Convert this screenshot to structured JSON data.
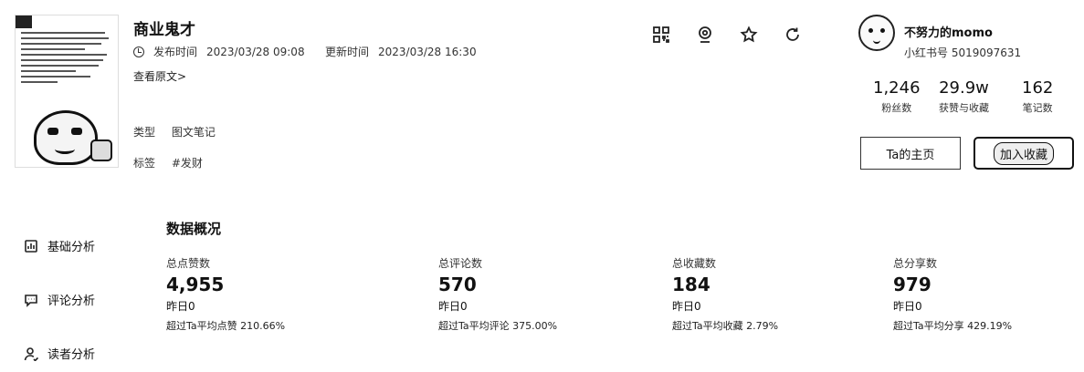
{
  "note": {
    "title": "商业鬼才",
    "publish_label": "发布时间",
    "publish_time": "2023/03/28 09:08",
    "update_label": "更新时间",
    "update_time": "2023/03/28 16:30",
    "view_source": "查看原文>",
    "type_label": "类型",
    "type_value": "图文笔记",
    "tag_label": "标签",
    "tag_value": "#发财",
    "thumbnail_caption": "我想去做一个商业",
    "thumbnail_footer": "接着我们的生活"
  },
  "toolbar_icons": [
    "qrcode-icon",
    "camera-icon",
    "star-icon",
    "refresh-icon"
  ],
  "author": {
    "name": "不努力的momo",
    "id_label": "小红书号",
    "id_value": "5019097631",
    "stats": [
      {
        "value": "1,246",
        "label": "粉丝数"
      },
      {
        "value": "29.9w",
        "label": "获赞与收藏"
      },
      {
        "value": "162",
        "label": "笔记数"
      }
    ],
    "home_button": "Ta的主页",
    "fav_button": "加入收藏"
  },
  "nav": [
    {
      "label": "基础分析",
      "icon": "chart-icon"
    },
    {
      "label": "评论分析",
      "icon": "comment-icon"
    },
    {
      "label": "读者分析",
      "icon": "user-icon"
    }
  ],
  "overview": {
    "title": "数据概况",
    "metrics": [
      {
        "label": "总点赞数",
        "value": "4,955",
        "yesterday": "昨日0",
        "compare": "超过Ta平均点赞 210.66%"
      },
      {
        "label": "总评论数",
        "value": "570",
        "yesterday": "昨日0",
        "compare": "超过Ta平均评论 375.00%"
      },
      {
        "label": "总收藏数",
        "value": "184",
        "yesterday": "昨日0",
        "compare": "超过Ta平均收藏 2.79%"
      },
      {
        "label": "总分享数",
        "value": "979",
        "yesterday": "昨日0",
        "compare": "超过Ta平均分享 429.19%"
      }
    ]
  }
}
